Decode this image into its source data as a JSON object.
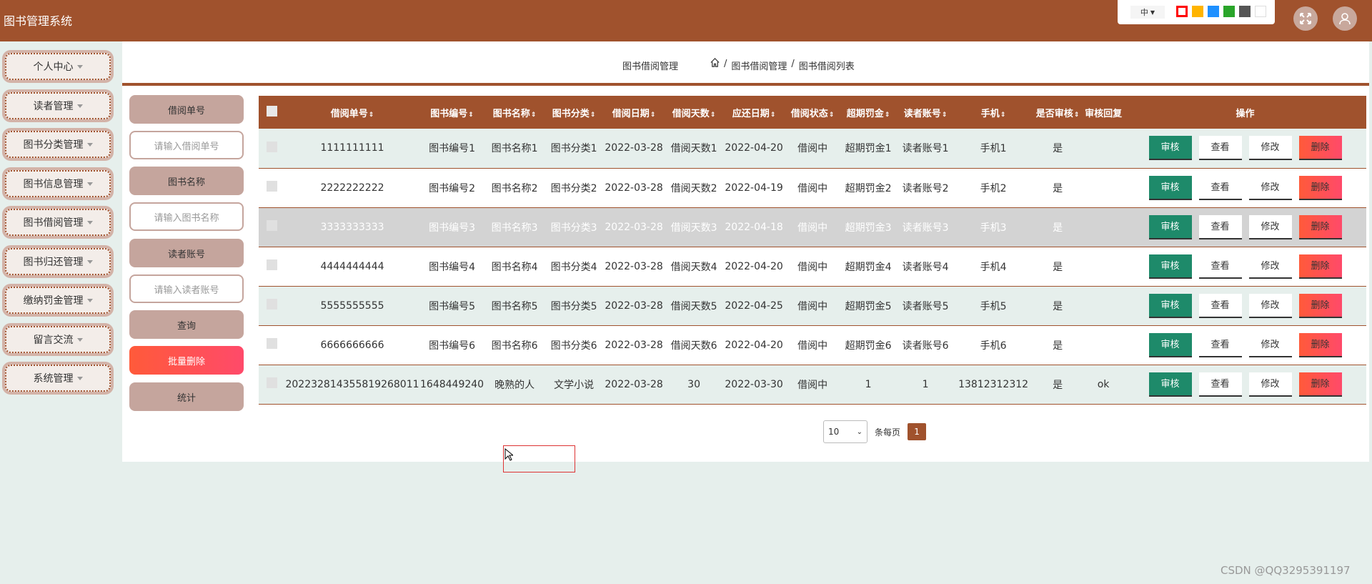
{
  "app": {
    "title": "图书管理系统"
  },
  "theme": {
    "lang": "中",
    "swatches": [
      "#ff0000",
      "#ffb400",
      "#1e90ff",
      "#2aa52a",
      "#555555",
      "#ffffff"
    ]
  },
  "sidebar": {
    "items": [
      {
        "label": "个人中心"
      },
      {
        "label": "读者管理"
      },
      {
        "label": "图书分类管理"
      },
      {
        "label": "图书信息管理"
      },
      {
        "label": "图书借阅管理"
      },
      {
        "label": "图书归还管理"
      },
      {
        "label": "缴纳罚金管理"
      },
      {
        "label": "留言交流"
      },
      {
        "label": "系统管理"
      }
    ]
  },
  "breadcrumb": {
    "title": "图书借阅管理",
    "level1": "图书借阅管理",
    "level2": "图书借阅列表",
    "sep": "/"
  },
  "search": {
    "field1_label": "借阅单号",
    "field1_placeholder": "请输入借阅单号",
    "field2_label": "图书名称",
    "field2_placeholder": "请输入图书名称",
    "field3_label": "读者账号",
    "field3_placeholder": "请输入读者账号",
    "query_label": "查询",
    "batch_delete_label": "批量删除",
    "stats_label": "统计"
  },
  "table": {
    "headers": [
      "借阅单号",
      "图书编号",
      "图书名称",
      "图书分类",
      "借阅日期",
      "借阅天数",
      "应还日期",
      "借阅状态",
      "超期罚金",
      "读者账号",
      "手机",
      "是否审核",
      "审核回复",
      "操作"
    ],
    "actions": {
      "audit": "审核",
      "view": "查看",
      "edit": "修改",
      "delete": "删除"
    },
    "rows": [
      {
        "c0": "1111111111",
        "c1": "图书编号1",
        "c2": "图书名称1",
        "c3": "图书分类1",
        "c4": "2022-03-28",
        "c5": "借阅天数1",
        "c6": "2022-04-20",
        "c7": "借阅中",
        "c8": "超期罚金1",
        "c9": "读者账号1",
        "c10": "手机1",
        "c11": "是",
        "c12": ""
      },
      {
        "c0": "2222222222",
        "c1": "图书编号2",
        "c2": "图书名称2",
        "c3": "图书分类2",
        "c4": "2022-03-28",
        "c5": "借阅天数2",
        "c6": "2022-04-19",
        "c7": "借阅中",
        "c8": "超期罚金2",
        "c9": "读者账号2",
        "c10": "手机2",
        "c11": "是",
        "c12": ""
      },
      {
        "c0": "3333333333",
        "c1": "图书编号3",
        "c2": "图书名称3",
        "c3": "图书分类3",
        "c4": "2022-03-28",
        "c5": "借阅天数3",
        "c6": "2022-04-18",
        "c7": "借阅中",
        "c8": "超期罚金3",
        "c9": "读者账号3",
        "c10": "手机3",
        "c11": "是",
        "c12": ""
      },
      {
        "c0": "4444444444",
        "c1": "图书编号4",
        "c2": "图书名称4",
        "c3": "图书分类4",
        "c4": "2022-03-28",
        "c5": "借阅天数4",
        "c6": "2022-04-20",
        "c7": "借阅中",
        "c8": "超期罚金4",
        "c9": "读者账号4",
        "c10": "手机4",
        "c11": "是",
        "c12": ""
      },
      {
        "c0": "5555555555",
        "c1": "图书编号5",
        "c2": "图书名称5",
        "c3": "图书分类5",
        "c4": "2022-03-28",
        "c5": "借阅天数5",
        "c6": "2022-04-25",
        "c7": "借阅中",
        "c8": "超期罚金5",
        "c9": "读者账号5",
        "c10": "手机5",
        "c11": "是",
        "c12": ""
      },
      {
        "c0": "6666666666",
        "c1": "图书编号6",
        "c2": "图书名称6",
        "c3": "图书分类6",
        "c4": "2022-03-28",
        "c5": "借阅天数6",
        "c6": "2022-04-20",
        "c7": "借阅中",
        "c8": "超期罚金6",
        "c9": "读者账号6",
        "c10": "手机6",
        "c11": "是",
        "c12": ""
      },
      {
        "c0": "20223281435581926801​1",
        "c1": "1648449240",
        "c2": "晚熟的人",
        "c3": "文学小说",
        "c4": "2022-03-28",
        "c5": "30",
        "c6": "2022-03-30",
        "c7": "借阅中",
        "c8": "1",
        "c9": "1",
        "c10": "13812312312",
        "c11": "是",
        "c12": "ok"
      }
    ]
  },
  "pagination": {
    "page_size": "10",
    "per_page_label": "条每页",
    "current_page": "1"
  },
  "watermark": "CSDN @QQ3295391197"
}
